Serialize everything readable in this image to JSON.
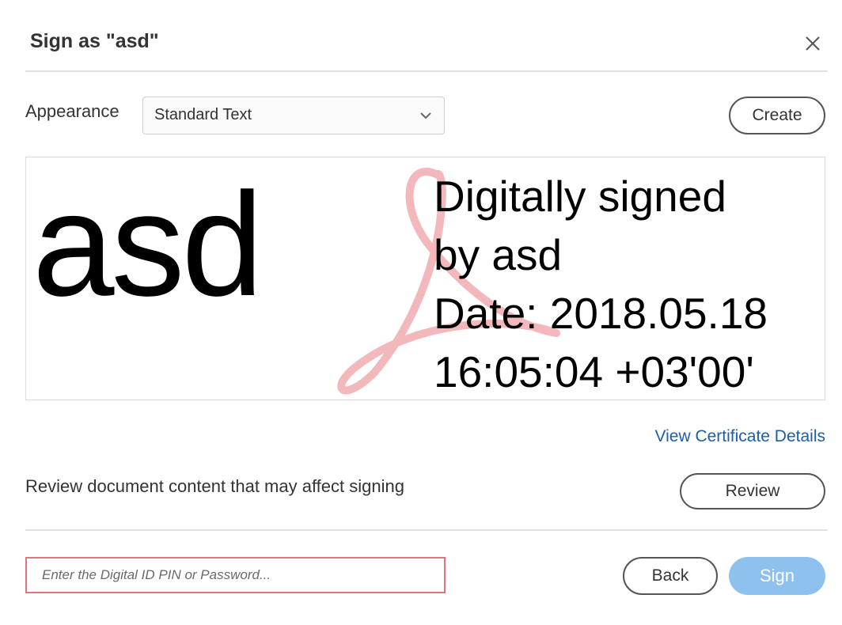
{
  "dialog": {
    "title": "Sign as \"asd\""
  },
  "appearance": {
    "label": "Appearance",
    "selected": "Standard Text",
    "create_label": "Create"
  },
  "preview": {
    "name": "asd",
    "lines": [
      "Digitally signed",
      "by asd",
      "Date: 2018.05.18",
      "16:05:04 +03'00'"
    ]
  },
  "certificate": {
    "link_label": "View Certificate Details"
  },
  "review": {
    "text": "Review document content that may affect signing",
    "button_label": "Review"
  },
  "footer": {
    "pin_placeholder": "Enter the Digital ID PIN or Password...",
    "back_label": "Back",
    "sign_label": "Sign"
  },
  "colors": {
    "link": "#1a5fa8",
    "sign_button": "#8fc1ef",
    "input_border": "#d9777e",
    "watermark": "#f2b8bc"
  }
}
